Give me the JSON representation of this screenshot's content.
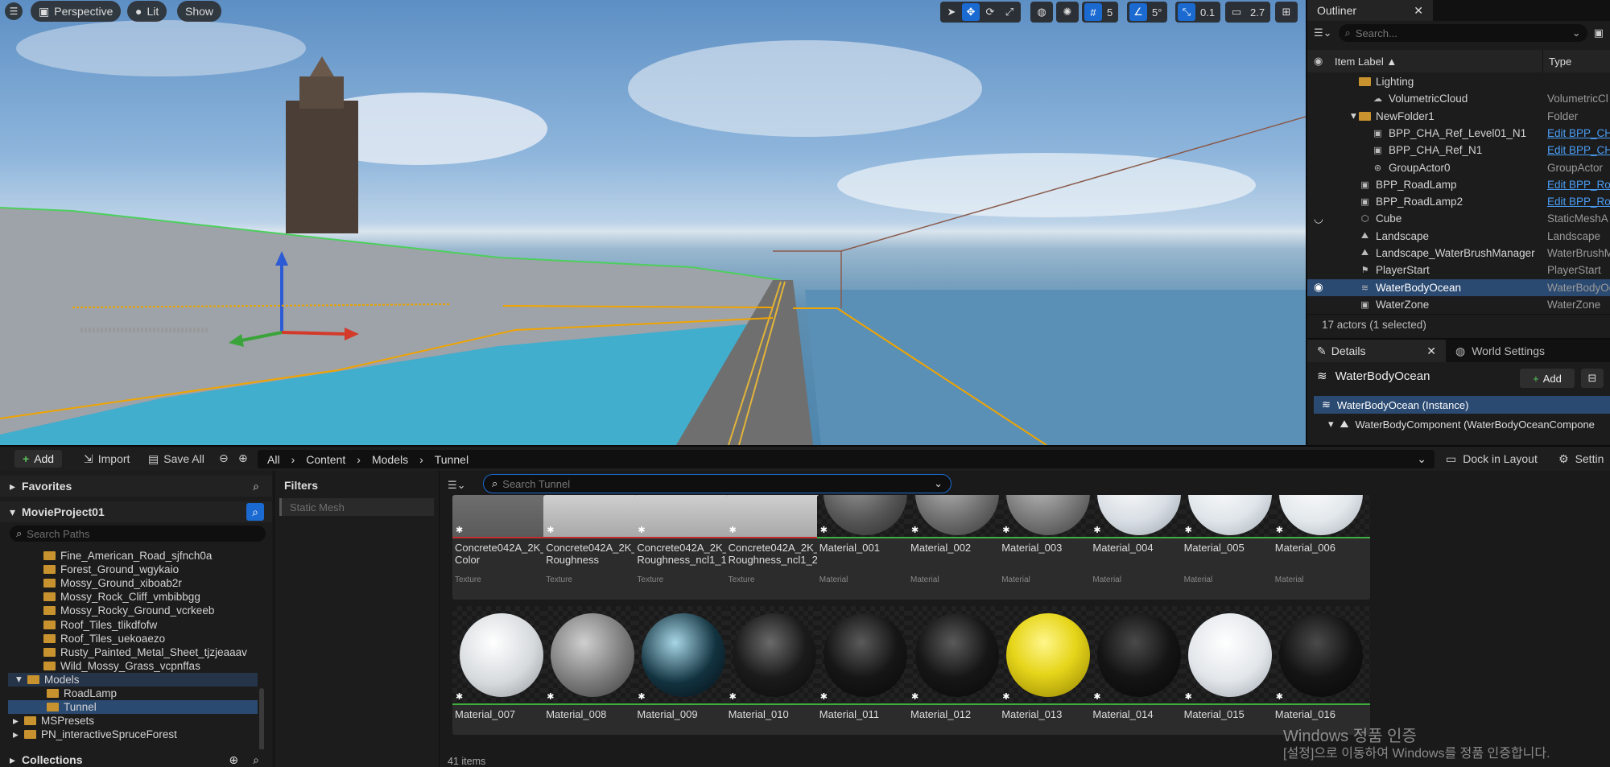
{
  "viewport": {
    "menu_icon": "hamburger-icon",
    "perspective_label": "Perspective",
    "lit_label": "Lit",
    "show_label": "Show",
    "grid_snap": "5",
    "angle_snap": "5°",
    "scale_snap": "0.1",
    "camera_speed": "2.7"
  },
  "outliner": {
    "tab_label": "Outliner",
    "search_placeholder": "Search...",
    "col_label": "Item Label ▲",
    "col_type": "Type",
    "rows": [
      {
        "label": "Lighting",
        "type": "",
        "icon": "folder-icon"
      },
      {
        "label": "VolumetricCloud",
        "type": "VolumetricCl",
        "icon": "cloud-icon"
      },
      {
        "label": "NewFolder1",
        "type": "Folder",
        "icon": "folder-icon"
      },
      {
        "label": "BPP_CHA_Ref_Level01_N1",
        "type": "Edit BPP_CHA",
        "icon": "blueprint-icon"
      },
      {
        "label": "BPP_CHA_Ref_N1",
        "type": "Edit BPP_CHA",
        "icon": "blueprint-icon"
      },
      {
        "label": "GroupActor0",
        "type": "GroupActor",
        "icon": "group-icon"
      },
      {
        "label": "BPP_RoadLamp",
        "type": "Edit BPP_Roa",
        "icon": "blueprint-icon"
      },
      {
        "label": "BPP_RoadLamp2",
        "type": "Edit BPP_Roa",
        "icon": "blueprint-icon"
      },
      {
        "label": "Cube",
        "type": "StaticMeshA",
        "icon": "cube-icon"
      },
      {
        "label": "Landscape",
        "type": "Landscape",
        "icon": "landscape-icon"
      },
      {
        "label": "Landscape_WaterBrushManager",
        "type": "WaterBrushM",
        "icon": "landscape-icon"
      },
      {
        "label": "PlayerStart",
        "type": "PlayerStart",
        "icon": "flag-icon"
      },
      {
        "label": "WaterBodyOcean",
        "type": "WaterBodyOc",
        "icon": "water-icon"
      },
      {
        "label": "WaterZone",
        "type": "WaterZone",
        "icon": "zone-icon"
      }
    ],
    "status": "17 actors (1 selected)"
  },
  "details": {
    "tab_label": "Details",
    "world_tab_label": "World Settings",
    "object_name": "WaterBodyOcean",
    "add_label": "Add",
    "instance_label": "WaterBodyOcean (Instance)",
    "component_label": "WaterBodyComponent (WaterBodyOceanCompone"
  },
  "content_browser": {
    "add_label": "Add",
    "import_label": "Import",
    "save_all_label": "Save All",
    "breadcrumbs": [
      "All",
      "Content",
      "Models",
      "Tunnel"
    ],
    "dock_label": "Dock in Layout",
    "settings_label": "Settin",
    "favorites_label": "Favorites",
    "project_label": "MovieProject01",
    "search_paths_placeholder": "Search Paths",
    "collections_label": "Collections",
    "filters_label": "Filters",
    "filter_chip": "Static Mesh",
    "search_placeholder": "Search Tunnel",
    "items_count": "41 items",
    "tree": [
      {
        "label": "Fine_American_Road_sjfnch0a",
        "depth": 3
      },
      {
        "label": "Forest_Ground_wgykaio",
        "depth": 3
      },
      {
        "label": "Mossy_Ground_xiboab2r",
        "depth": 3
      },
      {
        "label": "Mossy_Rock_Cliff_vmbibbgg",
        "depth": 3
      },
      {
        "label": "Mossy_Rocky_Ground_vcrkeeb",
        "depth": 3
      },
      {
        "label": "Roof_Tiles_tlikdfofw",
        "depth": 3
      },
      {
        "label": "Roof_Tiles_uekoaezo",
        "depth": 3
      },
      {
        "label": "Rusty_Painted_Metal_Sheet_tjzjeaaav",
        "depth": 3
      },
      {
        "label": "Wild_Mossy_Grass_vcpnffas",
        "depth": 3
      },
      {
        "label": "Models",
        "depth": 2
      },
      {
        "label": "RoadLamp",
        "depth": 3
      },
      {
        "label": "Tunnel",
        "depth": 3
      },
      {
        "label": "MSPresets",
        "depth": 1
      },
      {
        "label": "PN_interactiveSpruceForest",
        "depth": 1
      }
    ],
    "assets_row1": [
      {
        "name": "Concrete042A_2K_\nColor",
        "type": "Texture"
      },
      {
        "name": "Concrete042A_2K_\nRoughness",
        "type": "Texture"
      },
      {
        "name": "Concrete042A_2K_\nRoughness_ncl1_1",
        "type": "Texture"
      },
      {
        "name": "Concrete042A_2K_\nRoughness_ncl1_2",
        "type": "Texture"
      },
      {
        "name": "Material_001",
        "type": "Material"
      },
      {
        "name": "Material_002",
        "type": "Material"
      },
      {
        "name": "Material_003",
        "type": "Material"
      },
      {
        "name": "Material_004",
        "type": "Material"
      },
      {
        "name": "Material_005",
        "type": "Material"
      },
      {
        "name": "Material_006",
        "type": "Material"
      }
    ],
    "assets_row2": [
      {
        "name": "Material_007"
      },
      {
        "name": "Material_008"
      },
      {
        "name": "Material_009"
      },
      {
        "name": "Material_010"
      },
      {
        "name": "Material_011"
      },
      {
        "name": "Material_012"
      },
      {
        "name": "Material_013"
      },
      {
        "name": "Material_014"
      },
      {
        "name": "Material_015"
      },
      {
        "name": "Material_016"
      }
    ]
  },
  "watermark": {
    "line1": "Windows 정품 인증",
    "line2": "[설정]으로 이동하여 Windows를 정품 인증합니다."
  }
}
